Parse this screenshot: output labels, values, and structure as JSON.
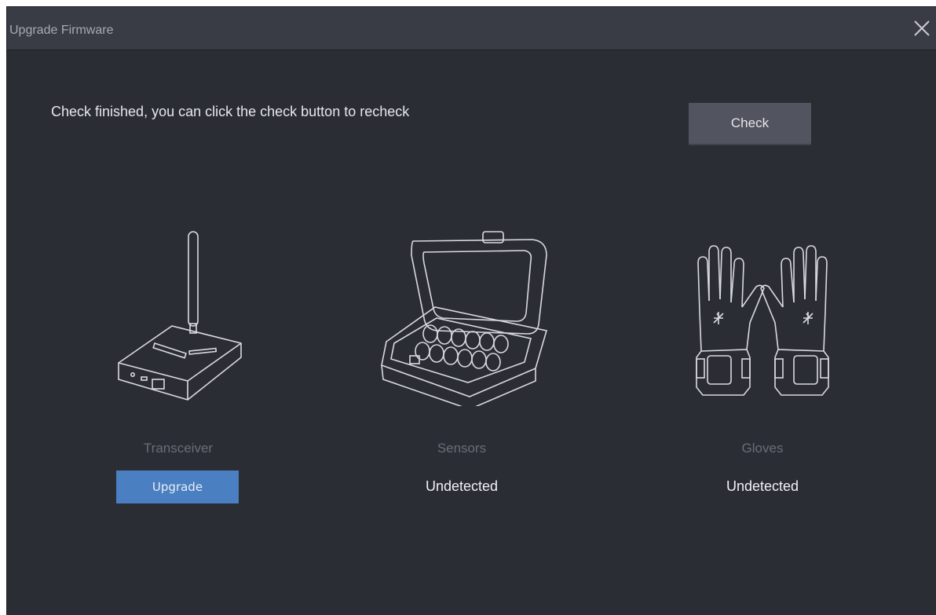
{
  "window": {
    "title": "Upgrade Firmware"
  },
  "main": {
    "message": "Check finished, you can click the check button to recheck",
    "check_label": "Check"
  },
  "devices": [
    {
      "icon": "transceiver-icon",
      "name": "Transceiver",
      "action_label": "Upgrade"
    },
    {
      "icon": "sensors-case-icon",
      "name": "Sensors",
      "status": "Undetected"
    },
    {
      "icon": "gloves-icon",
      "name": "Gloves",
      "status": "Undetected"
    }
  ],
  "colors": {
    "background": "#2b2d35",
    "titlebar": "#3a3c45",
    "check_button": "#52545f",
    "upgrade_button": "#4a7fc1",
    "muted_text": "#6b6d77"
  }
}
